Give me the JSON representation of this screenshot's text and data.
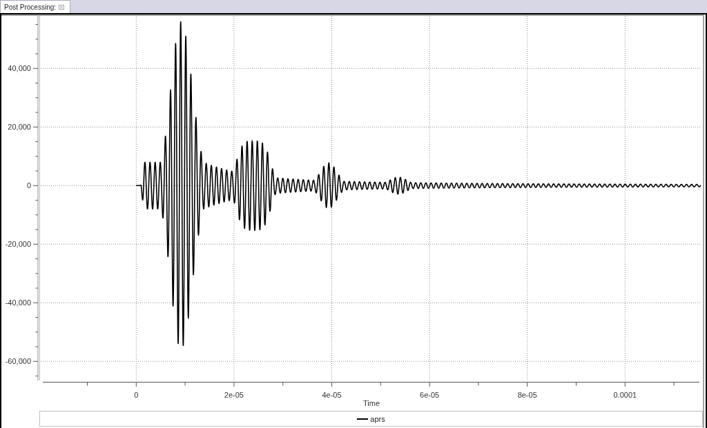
{
  "tabs": [
    {
      "label": "Post Processing:",
      "selected": true
    }
  ],
  "chart": {
    "y_axis": {
      "tick_labels": [
        "40,000",
        "20,000",
        "0",
        "-20,000",
        "-40,000",
        "-60,000"
      ]
    },
    "x_axis": {
      "title": "Time",
      "tick_labels": [
        "0",
        "2e-05",
        "4e-05",
        "6e-05",
        "8e-05",
        "0.0001"
      ]
    },
    "legend": [
      {
        "label": "aprs"
      }
    ]
  }
}
